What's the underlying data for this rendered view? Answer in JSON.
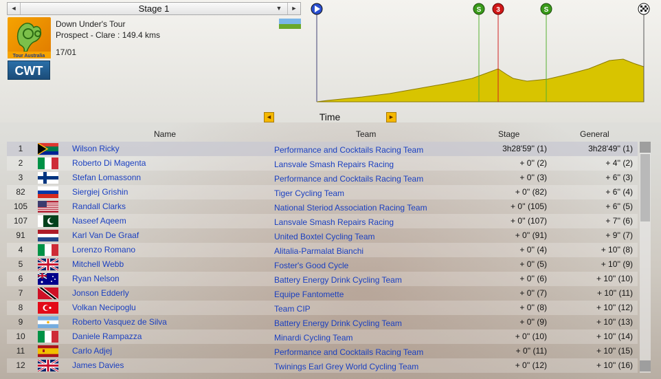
{
  "stage_selector": {
    "label": "Stage 1",
    "prev": "◄",
    "next": "►",
    "dropdown": "▼"
  },
  "race": {
    "name": "Down Under's Tour",
    "route": "Prospect - Clare : 149.4 kms",
    "date": "17/01",
    "badge": "CWT",
    "logo_text": "Tour Australia"
  },
  "profile": {
    "markers": [
      {
        "icon": "start-flag-icon",
        "color": "#2a4fd0"
      },
      {
        "icon": "sprint-icon",
        "label": "S",
        "color": "#3a9a1a"
      },
      {
        "icon": "climb-category-icon",
        "label": "3",
        "color": "#d01818"
      },
      {
        "icon": "sprint-icon",
        "label": "S",
        "color": "#3a9a1a"
      },
      {
        "icon": "finish-flag-icon",
        "color": "#222222"
      }
    ],
    "fill_color": "#d8c400"
  },
  "classification": {
    "label": "Time",
    "prev": "◄",
    "next": "►"
  },
  "table": {
    "headers": {
      "name": "Name",
      "team": "Team",
      "stage": "Stage",
      "general": "General"
    },
    "rows": [
      {
        "pos": "1",
        "flag": "south-africa",
        "name": "Wilson Ricky",
        "team": "Performance and Cocktails Racing Team",
        "stage": "3h28'59'' (1)",
        "general": "3h28'49'' (1)"
      },
      {
        "pos": "2",
        "flag": "italy",
        "name": "Roberto Di Magenta",
        "team": "Lansvale Smash Repairs Racing",
        "stage": "+ 0'' (2)",
        "general": "+ 4'' (2)"
      },
      {
        "pos": "3",
        "flag": "finland",
        "name": "Stefan Lomassonn",
        "team": "Performance and Cocktails Racing Team",
        "stage": "+ 0'' (3)",
        "general": "+ 6'' (3)"
      },
      {
        "pos": "82",
        "flag": "russia",
        "name": "Siergiej Grishin",
        "team": "Tiger Cycling Team",
        "stage": "+ 0'' (82)",
        "general": "+ 6'' (4)"
      },
      {
        "pos": "105",
        "flag": "usa",
        "name": "Randall Clarks",
        "team": "National Steriod Association Racing Team",
        "stage": "+ 0'' (105)",
        "general": "+ 6'' (5)"
      },
      {
        "pos": "107",
        "flag": "pakistan",
        "name": "Naseef Aqeem",
        "team": "Lansvale Smash Repairs Racing",
        "stage": "+ 0'' (107)",
        "general": "+ 7'' (6)"
      },
      {
        "pos": "91",
        "flag": "netherlands",
        "name": "Karl Van De Graaf",
        "team": "United Boxtel Cycling Team",
        "stage": "+ 0'' (91)",
        "general": "+ 9'' (7)"
      },
      {
        "pos": "4",
        "flag": "italy",
        "name": "Lorenzo Romano",
        "team": "Alitalia-Parmalat Bianchi",
        "stage": "+ 0'' (4)",
        "general": "+ 10'' (8)"
      },
      {
        "pos": "5",
        "flag": "uk",
        "name": "Mitchell Webb",
        "team": "Foster's Good Cycle",
        "stage": "+ 0'' (5)",
        "general": "+ 10'' (9)"
      },
      {
        "pos": "6",
        "flag": "australia",
        "name": "Ryan Nelson",
        "team": "Battery Energy Drink Cycling Team",
        "stage": "+ 0'' (6)",
        "general": "+ 10'' (10)"
      },
      {
        "pos": "7",
        "flag": "trinidad",
        "name": "Jonson Edderly",
        "team": "Equipe Fantomette",
        "stage": "+ 0'' (7)",
        "general": "+ 10'' (11)"
      },
      {
        "pos": "8",
        "flag": "turkey",
        "name": "Volkan Necipoglu",
        "team": "Team CIP",
        "stage": "+ 0'' (8)",
        "general": "+ 10'' (12)"
      },
      {
        "pos": "9",
        "flag": "argentina",
        "name": "Roberto Vasquez de Silva",
        "team": "Battery Energy Drink Cycling Team",
        "stage": "+ 0'' (9)",
        "general": "+ 10'' (13)"
      },
      {
        "pos": "10",
        "flag": "italy",
        "name": "Daniele Rampazza",
        "team": "Minardi Cycling Team",
        "stage": "+ 0'' (10)",
        "general": "+ 10'' (14)"
      },
      {
        "pos": "11",
        "flag": "spain",
        "name": "Carlo Adjej",
        "team": "Performance and Cocktails Racing Team",
        "stage": "+ 0'' (11)",
        "general": "+ 10'' (15)"
      },
      {
        "pos": "12",
        "flag": "uk",
        "name": "James Davies",
        "team": "Twinings Earl Grey World Cycling Team",
        "stage": "+ 0'' (12)",
        "general": "+ 10'' (16)"
      }
    ]
  }
}
